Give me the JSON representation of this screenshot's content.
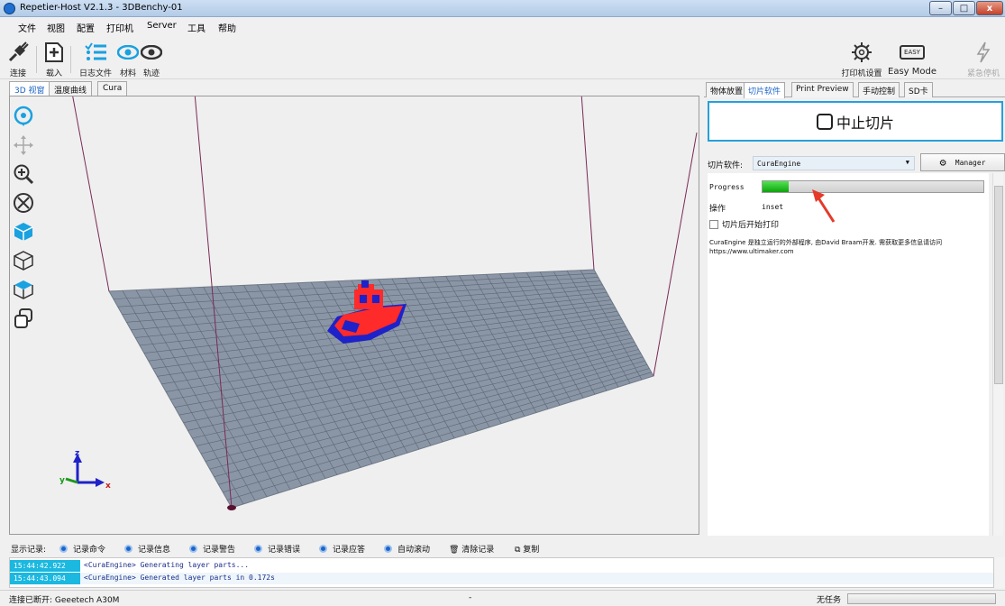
{
  "window": {
    "title": "Repetier-Host V2.1.3 - 3DBenchy-01",
    "minimize": "–",
    "maximize": "□",
    "close": "x"
  },
  "menu": [
    "文件",
    "视图",
    "配置",
    "打印机",
    "Server",
    "工具",
    "帮助"
  ],
  "toolbar": {
    "connect": "连接",
    "load": "载入",
    "log": "日志文件",
    "material": "材料",
    "track": "轨迹",
    "printer_settings": "打印机设置",
    "easy_mode": "Easy Mode",
    "easy_badge": "EASY",
    "emergency_stop": "紧急停机"
  },
  "left_tabs": [
    "3D 视窗",
    "温度曲线",
    "Cura"
  ],
  "right_tabs": [
    "物体放置",
    "切片软件",
    "Print Preview",
    "手动控制",
    "SD卡"
  ],
  "slicer": {
    "stop_label": "中止切片",
    "slicer_label": "切片软件:",
    "slicer_value": "CuraEngine",
    "manager_label": "Manager",
    "progress_label": "Progress",
    "progress": 0.12,
    "operation_label": "操作",
    "operation_value": "inset",
    "start_after_label": "切片后开始打印",
    "info_line1": "CuraEngine 是独立运行的外部程序, 由David Braam开发. 需获取更多信息请访问",
    "info_line2": "https://www.ultimaker.com"
  },
  "log_bar": {
    "label": "显示记录:",
    "options": [
      "记录命令",
      "记录信息",
      "记录警告",
      "记录错误",
      "记录应答",
      "自动滚动"
    ],
    "clear": "清除记录",
    "copy": "复制"
  },
  "log": [
    {
      "time": "15:44:42.922",
      "message": "<CuraEngine> Generating layer parts..."
    },
    {
      "time": "15:44:43.094",
      "message": "<CuraEngine> Generated layer parts in 0.172s"
    }
  ],
  "status": {
    "connection": "连接已断开: Geeetech A30M",
    "middle": "-",
    "task": "无任务"
  },
  "axes": {
    "x": "x",
    "y": "y",
    "z": "z"
  },
  "colors": {
    "accent": "#26a0da",
    "model_red": "#ff2a2a",
    "model_blue": "#1e22c8",
    "bed": "#8a96a6",
    "progress": "#14b514"
  }
}
